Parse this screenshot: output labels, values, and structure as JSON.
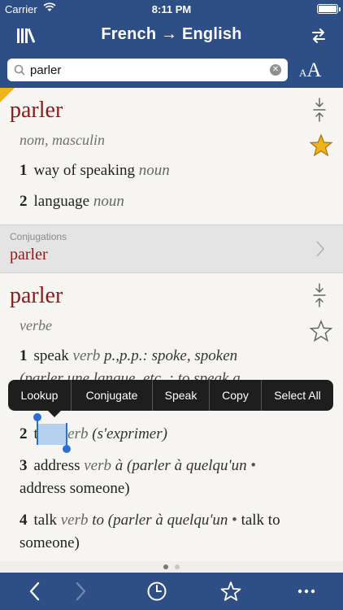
{
  "status": {
    "carrier": "Carrier",
    "time": "8:11 PM"
  },
  "nav": {
    "title": "French → English"
  },
  "search": {
    "value": "parler",
    "textsize_small": "A",
    "textsize_big": "A"
  },
  "entry1": {
    "headword": "parler",
    "pos": "nom, masculin",
    "senses": [
      {
        "num": "1",
        "text": "way of speaking",
        "pos": "noun"
      },
      {
        "num": "2",
        "text": "language",
        "pos": "noun"
      }
    ],
    "favorited": true
  },
  "conjugations": {
    "label": "Conjugations",
    "word": "parler"
  },
  "entry2": {
    "headword": "parler",
    "pos": "verbe",
    "favorited": false,
    "senses": [
      {
        "num": "1",
        "text": "speak",
        "pos": "verb",
        "extra": "p.,p.p.: spoke, spoken",
        "hidden_line": "(parler une langue, etc. : to speak a"
      },
      {
        "num": "2",
        "text": "talk",
        "pos": "verb",
        "note": "(s'exprimer)"
      },
      {
        "num": "3",
        "text": "address",
        "pos": "verb",
        "prep": "à",
        "note_open": "(parler à quelqu'un",
        "bullet": "•",
        "line2": "address someone)"
      },
      {
        "num": "4",
        "text": "talk",
        "pos": "verb",
        "prep": "to",
        "note_open": "(parler à quelqu'un",
        "bullet": "•",
        "tail": "talk to",
        "line2": "someone)"
      }
    ]
  },
  "context_menu": [
    "Lookup",
    "Conjugate",
    "Speak",
    "Copy",
    "Select All"
  ],
  "colors": {
    "bar": "#2d4f86",
    "headword": "#8b1a1a",
    "star": "#f1b31a"
  }
}
